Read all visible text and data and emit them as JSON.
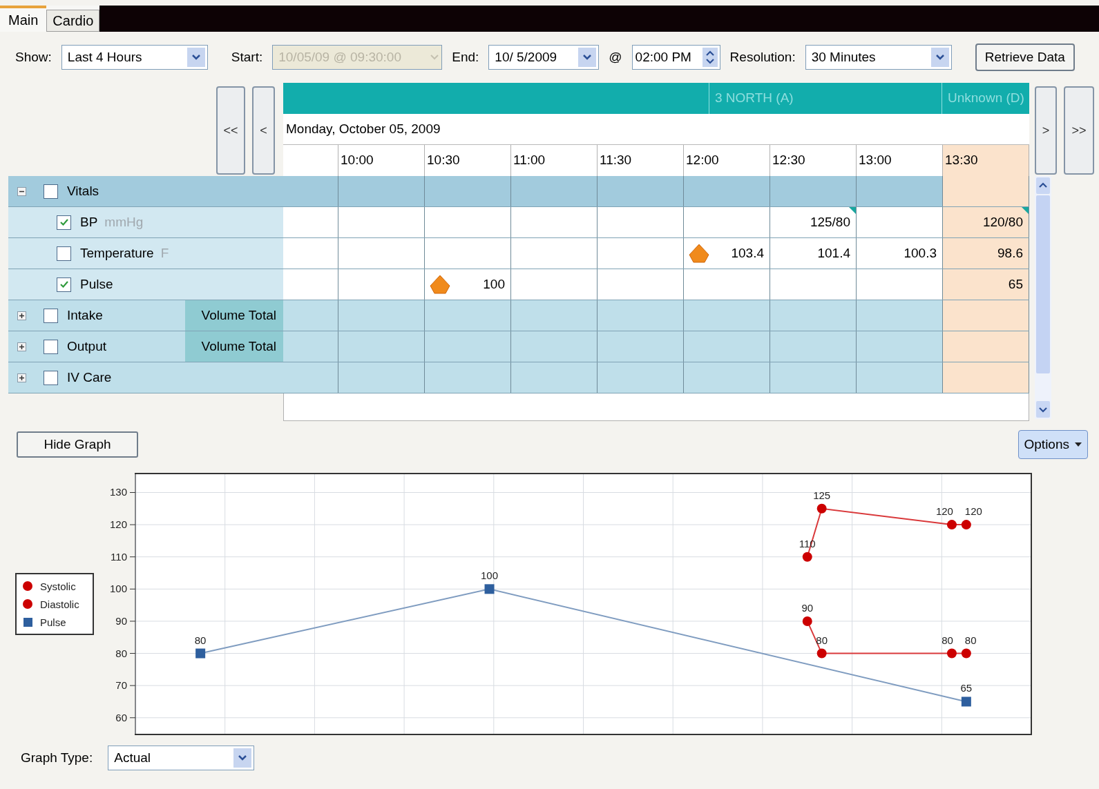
{
  "tabs": [
    {
      "label": "Main",
      "selected": true
    },
    {
      "label": "Cardio",
      "selected": false
    }
  ],
  "toolbar": {
    "show": {
      "label": "Show:",
      "value": "Last 4 Hours"
    },
    "start": {
      "label": "Start:",
      "value": "10/05/09 @ 09:30:00",
      "disabled": true
    },
    "end": {
      "label": "End:",
      "value": "10/ 5/2009"
    },
    "at": "@",
    "time": "02:00 PM",
    "resolution": {
      "label": "Resolution:",
      "value": "30 Minutes"
    },
    "retrieve_button": "Retrieve Data"
  },
  "navigation": {
    "first": "<<",
    "previous": "<",
    "next": ">",
    "last": ">>"
  },
  "grid": {
    "units": [
      {
        "label": "3 NORTH (A)"
      },
      {
        "label": "Unknown (D)"
      }
    ],
    "date": "Monday, October 05, 2009",
    "columns": [
      {
        "current": false
      },
      {
        "label": "10:00",
        "current": false
      },
      {
        "label": "10:30",
        "current": false
      },
      {
        "label": "11:00",
        "current": false
      },
      {
        "label": "11:30",
        "current": false
      },
      {
        "label": "12:00",
        "current": false
      },
      {
        "label": "12:30",
        "current": false
      },
      {
        "label": "13:00",
        "current": false
      },
      {
        "label": "13:30",
        "current": true
      }
    ],
    "rows": [
      {
        "kind": "group",
        "label": "Vitals",
        "expanded": true,
        "checked": false
      },
      {
        "kind": "item",
        "label": "BP",
        "unit": "mmHg",
        "checked": true,
        "cells": [
          null,
          null,
          null,
          null,
          null,
          null,
          {
            "value": "125/80",
            "alert": false,
            "flagged": true
          },
          null,
          {
            "value": "120/80",
            "alert": false,
            "flagged": true
          }
        ]
      },
      {
        "kind": "item",
        "label": "Temperature",
        "unit": "F",
        "checked": false,
        "cells": [
          null,
          null,
          null,
          null,
          null,
          {
            "value": "103.4",
            "alert": true,
            "flagged": false
          },
          {
            "value": "101.4",
            "alert": false,
            "flagged": false
          },
          {
            "value": "100.3",
            "alert": false,
            "flagged": false
          },
          {
            "value": "98.6",
            "alert": false,
            "flagged": false
          }
        ]
      },
      {
        "kind": "item",
        "label": "Pulse",
        "checked": true,
        "cells": [
          null,
          null,
          {
            "value": "100",
            "alert": true,
            "flagged": false
          },
          null,
          null,
          null,
          null,
          null,
          {
            "value": "65",
            "alert": false,
            "flagged": false
          }
        ]
      },
      {
        "kind": "group",
        "label": "Intake",
        "summary": "Volume Total",
        "expanded": false,
        "checked": false
      },
      {
        "kind": "group",
        "label": "Output",
        "summary": "Volume Total",
        "expanded": false,
        "checked": false
      },
      {
        "kind": "group",
        "label": "IV Care",
        "expanded": false,
        "checked": false
      }
    ]
  },
  "hide_graph_button": "Hide Graph",
  "options_button": "Options",
  "chart_data": {
    "type": "line",
    "ylim": [
      54.8,
      135.9
    ],
    "yticks": [
      60,
      70,
      80,
      90,
      100,
      110,
      120,
      130
    ],
    "data_labels": true,
    "categories": [
      null,
      null,
      null,
      null,
      null,
      null,
      null,
      null,
      null,
      null,
      null,
      null,
      null,
      null,
      null,
      null,
      null,
      null,
      null,
      null,
      null,
      null,
      null,
      null,
      null,
      null,
      null,
      null,
      null,
      null,
      null,
      null,
      null,
      null,
      null,
      null,
      null,
      null,
      null,
      null,
      null,
      null,
      null,
      null,
      null,
      null,
      null,
      null,
      null,
      null,
      null,
      null,
      null,
      null,
      null,
      null,
      null,
      null,
      null,
      null,
      null,
      null
    ],
    "grid": true,
    "legend": true,
    "series": [
      {
        "name": "Systolic",
        "color": "#cc0000",
        "marker": "circle",
        "values": [
          null,
          null,
          null,
          null,
          null,
          null,
          null,
          null,
          null,
          null,
          null,
          null,
          null,
          null,
          null,
          null,
          null,
          null,
          null,
          null,
          null,
          null,
          null,
          null,
          null,
          null,
          null,
          null,
          null,
          null,
          null,
          null,
          null,
          null,
          null,
          null,
          null,
          null,
          null,
          null,
          null,
          null,
          null,
          null,
          null,
          null,
          110,
          125,
          null,
          null,
          null,
          null,
          null,
          null,
          null,
          null,
          120,
          120,
          null,
          null,
          null,
          null
        ]
      },
      {
        "name": "Diastolic",
        "color": "#cc0000",
        "marker": "circle",
        "values": [
          null,
          null,
          null,
          null,
          null,
          null,
          null,
          null,
          null,
          null,
          null,
          null,
          null,
          null,
          null,
          null,
          null,
          null,
          null,
          null,
          null,
          null,
          null,
          null,
          null,
          null,
          null,
          null,
          null,
          null,
          null,
          null,
          null,
          null,
          null,
          null,
          null,
          null,
          null,
          null,
          null,
          null,
          null,
          null,
          null,
          null,
          90,
          80,
          null,
          null,
          null,
          null,
          null,
          null,
          null,
          null,
          80,
          80,
          null,
          null,
          null,
          null
        ]
      },
      {
        "name": "Pulse",
        "color": "#2e5f9e",
        "marker": "square",
        "values": [
          null,
          null,
          null,
          null,
          80,
          null,
          null,
          null,
          null,
          null,
          null,
          null,
          null,
          null,
          null,
          null,
          null,
          null,
          null,
          null,
          null,
          null,
          null,
          null,
          100,
          null,
          null,
          null,
          null,
          null,
          null,
          null,
          null,
          null,
          null,
          null,
          null,
          null,
          null,
          null,
          null,
          null,
          null,
          null,
          null,
          null,
          null,
          null,
          null,
          null,
          null,
          null,
          null,
          null,
          null,
          null,
          null,
          65,
          null,
          null,
          null,
          null
        ]
      }
    ]
  },
  "graph_type": {
    "label": "Graph Type:",
    "value": "Actual"
  }
}
